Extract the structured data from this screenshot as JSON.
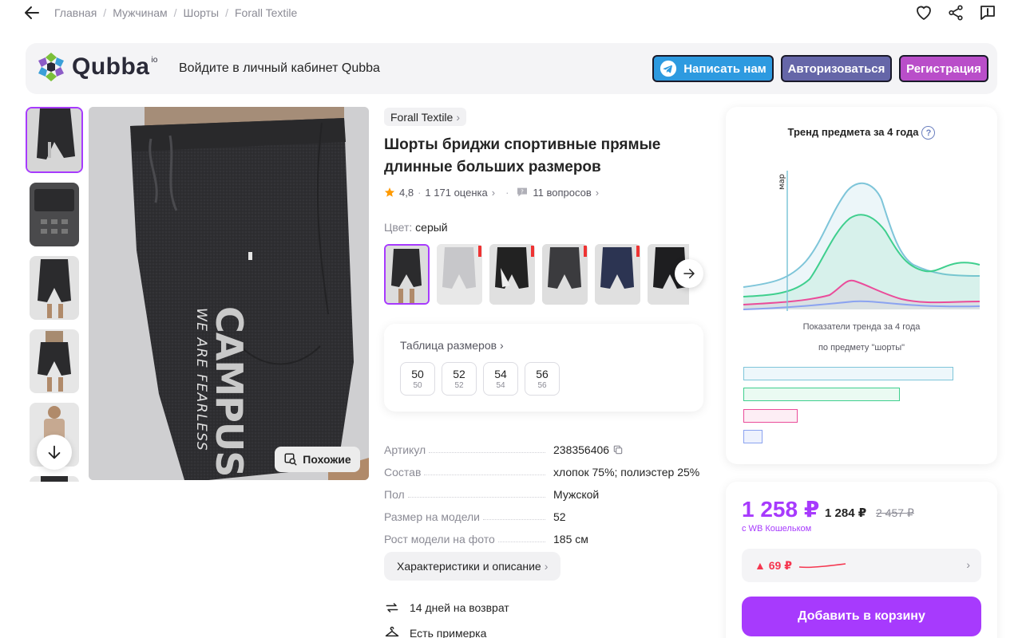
{
  "breadcrumbs": [
    "Главная",
    "Мужчинам",
    "Шорты",
    "Forall Textile"
  ],
  "qubba": {
    "logo_text": "Qubba",
    "logo_sup": "io",
    "prompt": "Войдите в личный кабинет Qubba",
    "write_us": "Написать нам",
    "login": "Авторизоваться",
    "register": "Регистрация"
  },
  "gallery": {
    "similar_label": "Похожие",
    "print_text": "CAMPUS",
    "print_sub": "WE ARE FEARLESS"
  },
  "product": {
    "brand": "Forall Textile",
    "title": "Шорты бриджи спортивные прямые длинные больших размеров",
    "rating": "4,8",
    "reviews": "1 171 оценка",
    "questions": "11 вопросов",
    "color_label": "Цвет:",
    "color_value": "серый"
  },
  "sizes": {
    "title": "Таблица размеров",
    "items": [
      {
        "size": "50",
        "sub": "50"
      },
      {
        "size": "52",
        "sub": "52"
      },
      {
        "size": "54",
        "sub": "54"
      },
      {
        "size": "56",
        "sub": "56"
      }
    ]
  },
  "specs": [
    {
      "key": "Артикул",
      "value": "238356406"
    },
    {
      "key": "Состав",
      "value": "хлопок 75%; полиэстер 25%"
    },
    {
      "key": "Пол",
      "value": "Мужской"
    },
    {
      "key": "Размер на модели",
      "value": "52"
    },
    {
      "key": "Рост модели на фото",
      "value": "185 см"
    }
  ],
  "desc_button": "Характеристики и описание",
  "features": [
    "14 дней на возврат",
    "Есть примерка"
  ],
  "trend": {
    "title": "Тренд предмета за 4 года",
    "month_marker": "мар",
    "caption_1": "Показатели тренда за 4 года",
    "caption_2": "по предмету \"шорты\"",
    "colors": {
      "blue": "#7ec5d9",
      "green": "#3fcf8e",
      "pink": "#ea4c9a",
      "lavender": "#8ba3f0"
    }
  },
  "price": {
    "current": "1 258 ₽",
    "regular": "1 284 ₽",
    "old": "2 457 ₽",
    "wallet": "с WB Кошельком",
    "history_delta": "▲ 69 ₽",
    "cart_button": "Добавить в корзину"
  },
  "colors": {
    "accent": "#a73afd",
    "telegram": "#2d9ae0",
    "auth": "#6566a8",
    "register": "#b94ec9",
    "price_up": "#f5364f"
  }
}
